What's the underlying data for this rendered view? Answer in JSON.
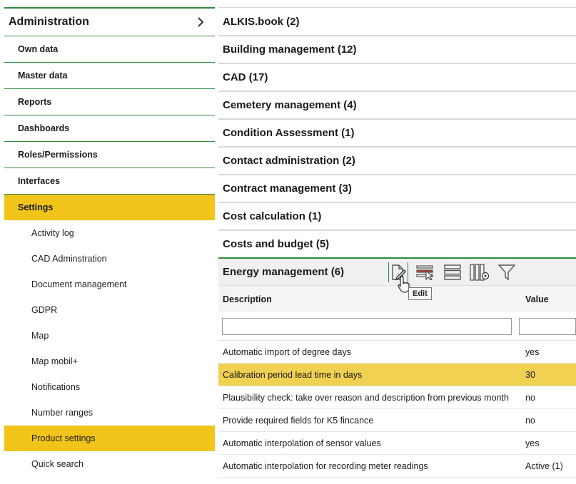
{
  "sidebar": {
    "title": "Administration",
    "items": [
      "Own data",
      "Master data",
      "Reports",
      "Dashboards",
      "Roles/Permissions",
      "Interfaces",
      "Settings"
    ],
    "active_item": "Settings",
    "subitems": [
      "Activity log",
      "CAD Adminstration",
      "Document management",
      "GDPR",
      "Map",
      "Map mobil+",
      "Notifications",
      "Number ranges",
      "Product settings",
      "Quick search"
    ],
    "active_subitem": "Product settings"
  },
  "groups": [
    "ALKIS.book (2)",
    "Building management (12)",
    "CAD (17)",
    "Cemetery management (4)",
    "Condition Assessment (1)",
    "Contact administration (2)",
    "Contract management (3)",
    "Cost calculation (1)",
    "Costs and budget (5)"
  ],
  "expanded_group": {
    "title": "Energy management (6)",
    "toolbar": [
      "edit-icon",
      "select-icon",
      "list-icon",
      "columns-settings-icon",
      "filter-icon"
    ],
    "tooltip": "Edit",
    "columns": [
      "Description",
      "Value"
    ],
    "filters": {
      "description": "",
      "value": ""
    },
    "rows": [
      {
        "description": "Automatic import of degree days",
        "value": "yes"
      },
      {
        "description": "Calibration period lead time in days",
        "value": "30"
      },
      {
        "description": "Plausibility check: take over reason and description from previous month",
        "value": "no"
      },
      {
        "description": "Provide required fields for K5 fincance",
        "value": "no"
      },
      {
        "description": "Automatic interpolation of sensor values",
        "value": "yes"
      },
      {
        "description": "Automatic interpolation for recording meter readings",
        "value": "Active (1)"
      }
    ],
    "selected_row_index": 1
  },
  "colors": {
    "accent_green": "#2e8b3e",
    "highlight_yellow": "#f0c419",
    "row_highlight": "#f1d152"
  }
}
